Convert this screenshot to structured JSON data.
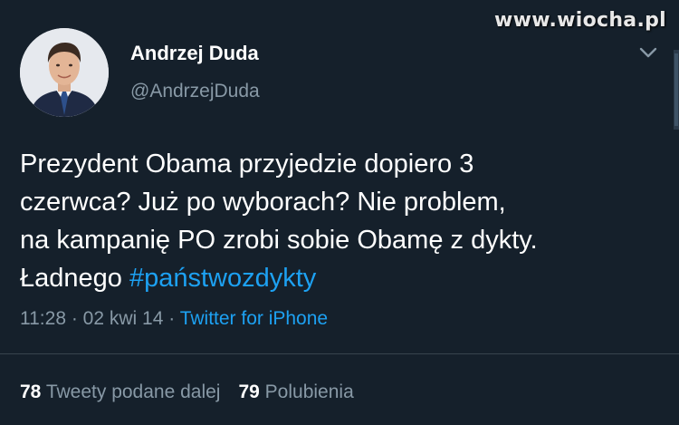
{
  "watermark": "www.wiocha.pl",
  "user": {
    "name": "Andrzej Duda",
    "handle": "@AndrzejDuda"
  },
  "tweet": {
    "lines": [
      "Prezydent Obama przyjedzie dopiero 3",
      "czerwca? Już po wyborach? Nie problem,",
      "na kampanię PO zrobi sobie Obamę z dykty."
    ],
    "last_line_prefix": "Ładnego ",
    "hashtag": "#państwozdykty"
  },
  "meta": {
    "time": "11:28",
    "sep1": " · ",
    "date": "02 kwi 14",
    "sep2": " · ",
    "source": "Twitter for iPhone"
  },
  "stats": {
    "retweets_count": "78",
    "retweets_label": "Tweety podane dalej",
    "likes_count": "79",
    "likes_label": "Polubienia"
  },
  "colors": {
    "background": "#15202b",
    "link": "#1da1f2",
    "secondary_text": "#8899a6"
  },
  "icons": [
    "chevron-down-icon"
  ]
}
